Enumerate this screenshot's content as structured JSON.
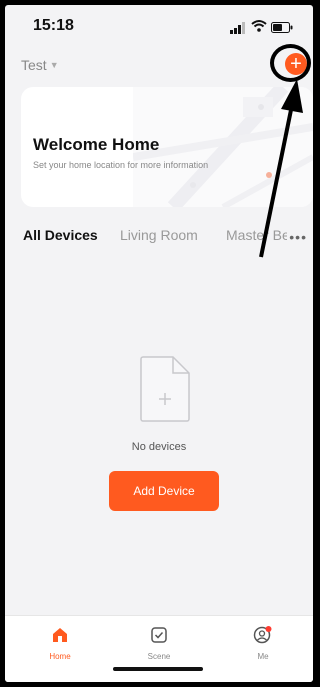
{
  "status_bar": {
    "time": "15:18"
  },
  "header": {
    "home_name": "Test",
    "add_icon": "plus-circle-icon"
  },
  "welcome_card": {
    "title": "Welcome Home",
    "subtitle": "Set your home location for more information"
  },
  "tabs": [
    {
      "label": "All Devices",
      "active": true
    },
    {
      "label": "Living Room",
      "active": false
    },
    {
      "label": "Master Be",
      "active": false
    }
  ],
  "tabs_more": "•••",
  "empty_state": {
    "text": "No devices",
    "button_label": "Add Device"
  },
  "bottom_nav": [
    {
      "label": "Home",
      "icon": "home-icon",
      "active": true
    },
    {
      "label": "Scene",
      "icon": "scene-check-icon",
      "active": false
    },
    {
      "label": "Me",
      "icon": "profile-icon",
      "active": false
    }
  ],
  "colors": {
    "accent": "#ff5a1f",
    "background": "#f3f3f5"
  }
}
